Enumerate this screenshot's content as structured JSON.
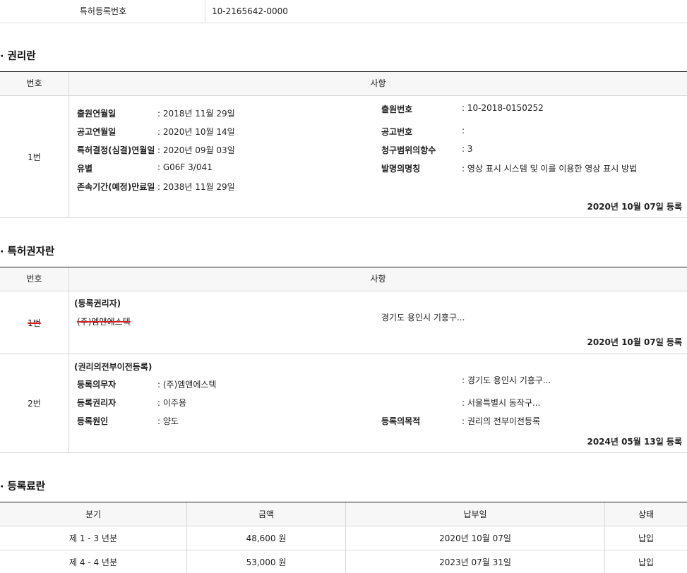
{
  "patent_number": {
    "label": "특허등록번호",
    "value": "10-2165642-0000"
  },
  "rights": {
    "title": "· 권리란",
    "header": {
      "no": "번호",
      "item": "사항"
    },
    "row": {
      "no": "1번",
      "left": [
        {
          "label": "출원연월일",
          "value": ": 2018년 11월 29일"
        },
        {
          "label": "공고연월일",
          "value": ": 2020년 10월 14일"
        },
        {
          "label": "특허결정(심결)연월일",
          "value": ": 2020년 09월 03일"
        },
        {
          "label": "유별",
          "value": ": G06F 3/041"
        },
        {
          "label": "존속기간(예정)만료일",
          "value": ": 2038년 11월 29일"
        }
      ],
      "right": [
        {
          "label": "출원번호",
          "value": ": 10-2018-0150252"
        },
        {
          "label": "공고번호",
          "value": ":"
        },
        {
          "label": "청구범위의항수",
          "value": ": 3"
        },
        {
          "label": "발명의명칭",
          "value": ": 영상 표시 시스템 및 이를 이용한 영상 표시 방법"
        }
      ],
      "registered": "2020년 10월 07일 등록"
    }
  },
  "owners": {
    "title": "· 특허권자란",
    "header": {
      "no": "번호",
      "item": "사항"
    },
    "row1": {
      "no": "1번",
      "category": "(등록권리자)",
      "name": "(주)엠앤에스텍",
      "address": "경기도 용인시 기흥구...",
      "registered": "2020년 10월 07일 등록"
    },
    "row2": {
      "no": "2번",
      "category": "(권리의전부이전등록)",
      "fields": [
        {
          "label": "등록의무자",
          "value": ": (주)엠앤에스텍"
        },
        {
          "label": "등록권리자",
          "value": ": 이주용"
        },
        {
          "label": "등록원인",
          "value": ": 양도"
        }
      ],
      "right": [
        {
          "label": "",
          "value": ": 경기도 용인시 기흥구..."
        },
        {
          "label": "",
          "value": ": 서울특별시 동작구..."
        },
        {
          "label": "등록의목적",
          "value": ": 권리의 전부이전등록"
        }
      ],
      "registered": "2024년 05월 13일 등록"
    }
  },
  "fees": {
    "title": "· 등록료란",
    "header": {
      "period": "분기",
      "amount": "금액",
      "paid_date": "납부일",
      "status": "상태"
    },
    "rows": [
      {
        "period": "제 1 - 3 년분",
        "amount": "48,600 원",
        "paid_date": "2020년 10월 07일",
        "status": "납입"
      },
      {
        "period": "제 4 - 4 년분",
        "amount": "53,000 원",
        "paid_date": "2023년 07월 31일",
        "status": "납입"
      }
    ]
  }
}
